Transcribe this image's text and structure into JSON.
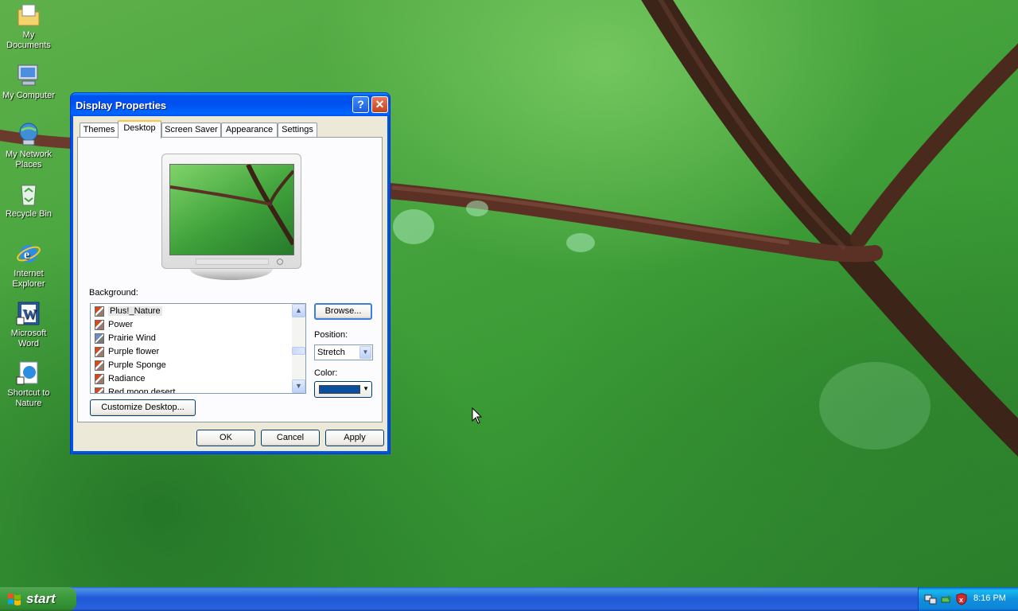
{
  "desktop_icons": [
    {
      "label": "My Documents",
      "icon": "my-documents-icon"
    },
    {
      "label": "My Computer",
      "icon": "my-computer-icon"
    },
    {
      "label": "My Network Places",
      "icon": "network-places-icon"
    },
    {
      "label": "Recycle Bin",
      "icon": "recycle-bin-icon"
    },
    {
      "label": "Internet Explorer",
      "icon": "internet-explorer-icon"
    },
    {
      "label": "Microsoft Word",
      "icon": "word-icon"
    },
    {
      "label": "Shortcut to Nature",
      "icon": "shortcut-icon"
    }
  ],
  "dialog": {
    "title": "Display Properties",
    "help_icon": "?",
    "close_icon": "✕",
    "tabs": [
      "Themes",
      "Desktop",
      "Screen Saver",
      "Appearance",
      "Settings"
    ],
    "active_tab": "Desktop",
    "background_label": "Background:",
    "background_items": [
      {
        "label": "Plus!_Nature",
        "selected": true
      },
      {
        "label": "Power",
        "selected": false
      },
      {
        "label": "Prairie Wind",
        "selected": false
      },
      {
        "label": "Purple flower",
        "selected": false
      },
      {
        "label": "Purple Sponge",
        "selected": false
      },
      {
        "label": "Radiance",
        "selected": false
      },
      {
        "label": "Red moon desert",
        "selected": false
      }
    ],
    "browse_label": "Browse...",
    "position_label": "Position:",
    "position_value": "Stretch",
    "color_label": "Color:",
    "color_value": "#0a4f9e",
    "customize_label": "Customize Desktop...",
    "ok_label": "OK",
    "cancel_label": "Cancel",
    "apply_label": "Apply"
  },
  "taskbar": {
    "start_label": "start",
    "clock": "8:16 PM",
    "tray_icons": [
      "network-icon",
      "safely-remove-icon",
      "security-shield-icon"
    ]
  },
  "colors": {
    "titlebar": "#0054e3",
    "taskbar": "#245edb",
    "start_button": "#3c9a3c"
  }
}
